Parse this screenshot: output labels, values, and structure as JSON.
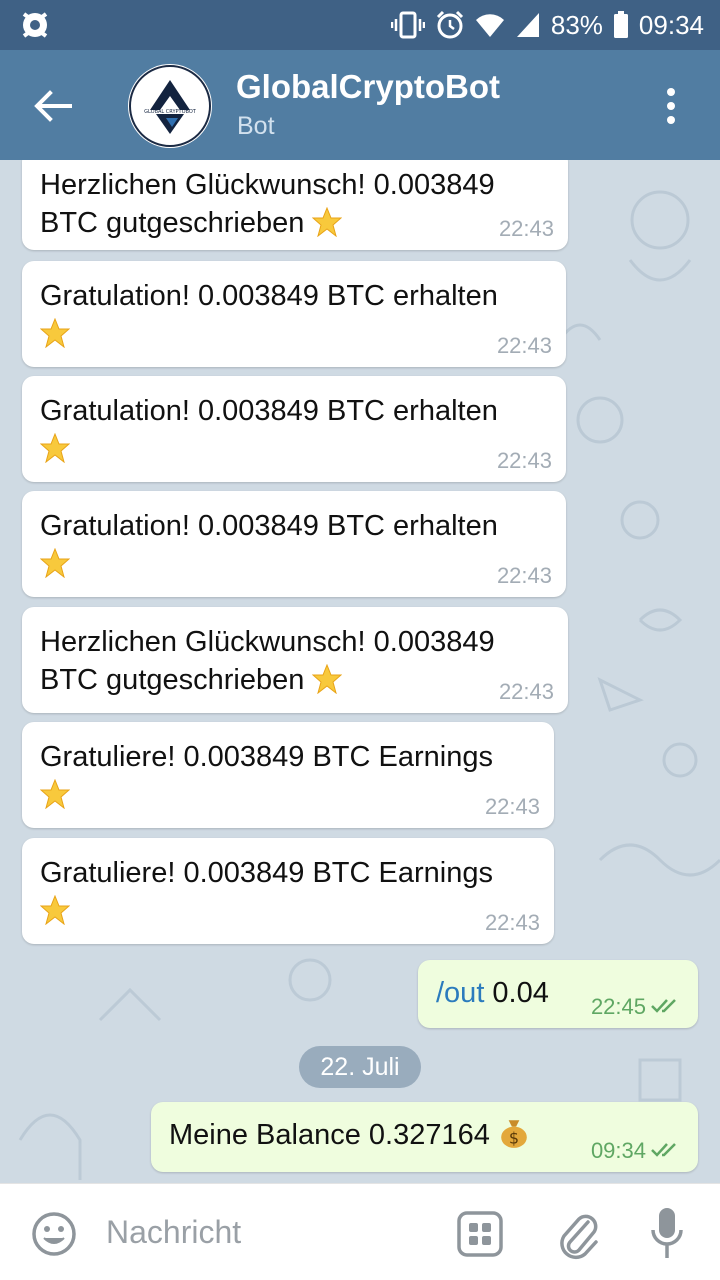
{
  "status_bar": {
    "battery": "83%",
    "time": "09:34"
  },
  "header": {
    "title": "GlobalCryptoBot",
    "subtitle": "Bot",
    "avatar_text": "GLOBAL CRYPTOBOT"
  },
  "messages": [
    {
      "text": "Herzlichen Glückwunsch! 0.003849\nBTC gutgeschrieben",
      "time": "22:43"
    },
    {
      "text": "Gratulation! 0.003849 BTC erhalten",
      "time": "22:43"
    },
    {
      "text": "Gratulation! 0.003849 BTC erhalten",
      "time": "22:43"
    },
    {
      "text": "Gratulation! 0.003849 BTC erhalten",
      "time": "22:43"
    },
    {
      "text": "Herzlichen Glückwunsch! 0.003849\nBTC gutgeschrieben",
      "time": "22:43"
    },
    {
      "text": "Gratuliere! 0.003849 BTC Earnings",
      "time": "22:43"
    },
    {
      "text": "Gratuliere! 0.003849 BTC Earnings",
      "time": "22:43"
    }
  ],
  "outgoing": [
    {
      "command": "/out",
      "text": " 0.04",
      "time": "22:45"
    },
    {
      "text": "Meine Balance 0.327164",
      "time": "09:34"
    }
  ],
  "date_separator": "22. Juli",
  "input": {
    "placeholder": "Nachricht"
  },
  "colors": {
    "status_bar": "#3f6185",
    "app_bar": "#517da2",
    "chat_bg": "#cfdae3",
    "outgoing_bubble": "#effdde",
    "command_link": "#2b7bbd",
    "read_check": "#5fa763"
  },
  "icons": [
    "avast-icon",
    "vibrate-icon",
    "alarm-icon",
    "wifi-icon",
    "signal-icon",
    "battery-icon",
    "back-arrow-icon",
    "more-vert-icon",
    "star-emoji-icon",
    "money-bag-emoji-icon",
    "double-check-icon",
    "emoji-icon",
    "bot-keyboard-icon",
    "attach-icon",
    "microphone-icon"
  ]
}
